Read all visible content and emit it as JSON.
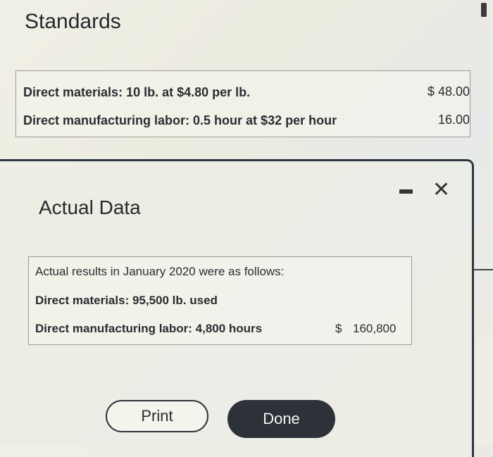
{
  "standards": {
    "title": "Standards",
    "rows": [
      {
        "label": "Direct materials: 10 lb. at $4.80 per lb.",
        "amount": "$ 48.00"
      },
      {
        "label": "Direct manufacturing labor: 0.5 hour at $32 per hour",
        "amount": "16.00"
      }
    ]
  },
  "dialog": {
    "title": "Actual Data",
    "intro": "Actual results in January 2020 were as follows:",
    "rows": [
      {
        "label": "Direct materials: 95,500 lb. used"
      },
      {
        "label": "Direct manufacturing labor: 4,800 hours",
        "currency": "$",
        "amount": "160,800"
      }
    ],
    "print_label": "Print",
    "done_label": "Done"
  }
}
